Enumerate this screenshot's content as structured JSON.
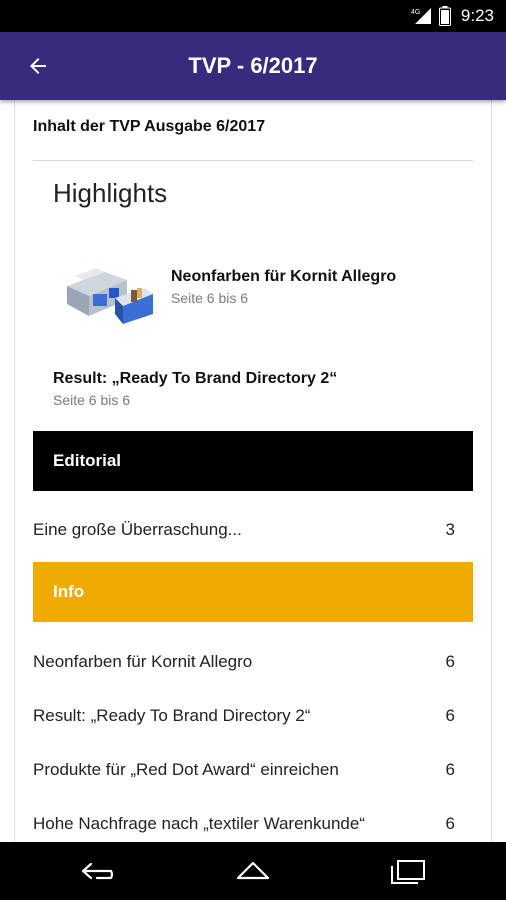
{
  "status_bar": {
    "time": "9:23",
    "icons": [
      "network-4g-icon",
      "signal-icon",
      "battery-icon"
    ]
  },
  "app_bar": {
    "title": "TVP - 6/2017",
    "back_icon": "arrow-back-icon",
    "color": "#372b7e"
  },
  "issue": {
    "heading": "Inhalt der TVP Ausgabe 6/2017"
  },
  "highlights": {
    "title": "Highlights",
    "items": [
      {
        "title": "Neonfarben für Kornit Allegro",
        "pages": "Seite 6 bis 6",
        "has_thumbnail": true
      },
      {
        "title": "Result: „Ready To Brand Directory 2“",
        "pages": "Seite 6 bis 6",
        "has_thumbnail": false
      }
    ]
  },
  "sections": [
    {
      "name": "Editorial",
      "color": "#000000",
      "entries": [
        {
          "title": "Eine große Überraschung...",
          "page": "3"
        }
      ]
    },
    {
      "name": "Info",
      "color": "#f0ab00",
      "entries": [
        {
          "title": "Neonfarben für Kornit Allegro",
          "page": "6"
        },
        {
          "title": "Result: „Ready To Brand Directory 2“",
          "page": "6"
        },
        {
          "title": "Produkte für „Red Dot Award“ einreichen",
          "page": "6"
        },
        {
          "title": "Hohe Nachfrage nach „textiler Warenkunde“",
          "page": "6"
        }
      ]
    }
  ],
  "nav_bar": {
    "icons": [
      "back-nav-icon",
      "home-nav-icon",
      "recents-nav-icon"
    ]
  }
}
